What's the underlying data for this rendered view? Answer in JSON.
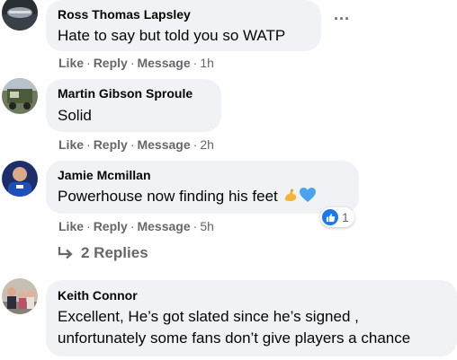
{
  "comments": [
    {
      "author": "Ross Thomas Lapsley",
      "text": "Hate to say but told you so WATP",
      "actions": {
        "like": "Like",
        "reply": "Reply",
        "message": "Message",
        "time": "1h"
      },
      "more_label": "···"
    },
    {
      "author": "Martin Gibson Sproule",
      "text": "Solid",
      "actions": {
        "like": "Like",
        "reply": "Reply",
        "message": "Message",
        "time": "2h"
      }
    },
    {
      "author": "Jamie Mcmillan",
      "text": "Powerhouse now finding his feet",
      "actions": {
        "like": "Like",
        "reply": "Reply",
        "message": "Message",
        "time": "5h"
      },
      "reaction": {
        "icon": "like-icon",
        "count": "1"
      }
    },
    {
      "author": "Keith Connor",
      "text_line1": "Excellent, He’s got slated since he’s signed ,",
      "text_line2": "unfortunately some fans don’t give players a chance"
    }
  ],
  "replies_label": "2 Replies",
  "separator": "·",
  "colors": {
    "bubble": "#f0f2f5",
    "muted": "#65676b",
    "like_blue": "#1877f2"
  }
}
